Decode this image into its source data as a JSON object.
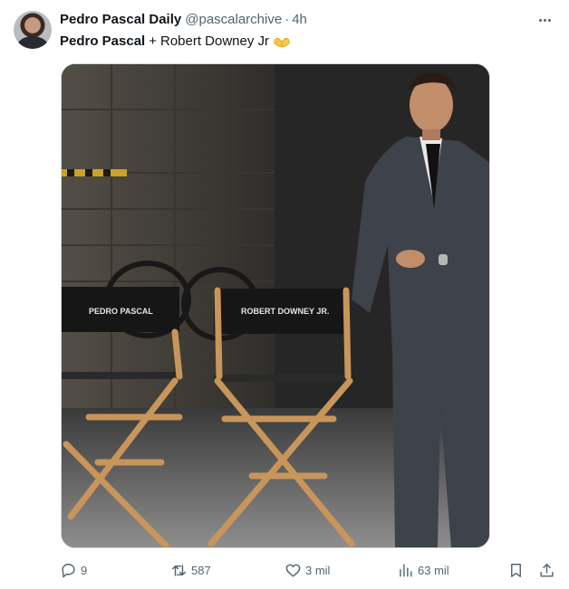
{
  "author": {
    "display_name": "Pedro Pascal Daily",
    "handle": "@pascalarchive",
    "separator": "·",
    "time": "4h"
  },
  "tweet": {
    "name_one": "Pedro Pascal",
    "joiner": "+",
    "name_two": "Robert Downey Jr",
    "emoji": "heart-hands-emoji"
  },
  "media": {
    "chair_left_label": "PEDRO PASCAL",
    "chair_right_label": "ROBERT DOWNEY JR."
  },
  "actions": {
    "replies": "9",
    "retweets": "587",
    "likes": "3 mil",
    "views": "63 mil"
  },
  "icons": {
    "reply": "reply-icon",
    "retweet": "retweet-icon",
    "like": "heart-icon",
    "views": "views-chart-icon",
    "bookmark": "bookmark-icon",
    "share": "share-icon",
    "more": "more-dots-icon"
  },
  "colors": {
    "text_primary": "#0f1419",
    "text_secondary": "#536471",
    "border": "#cfd9de",
    "emoji_yellow": "#f7c948"
  }
}
